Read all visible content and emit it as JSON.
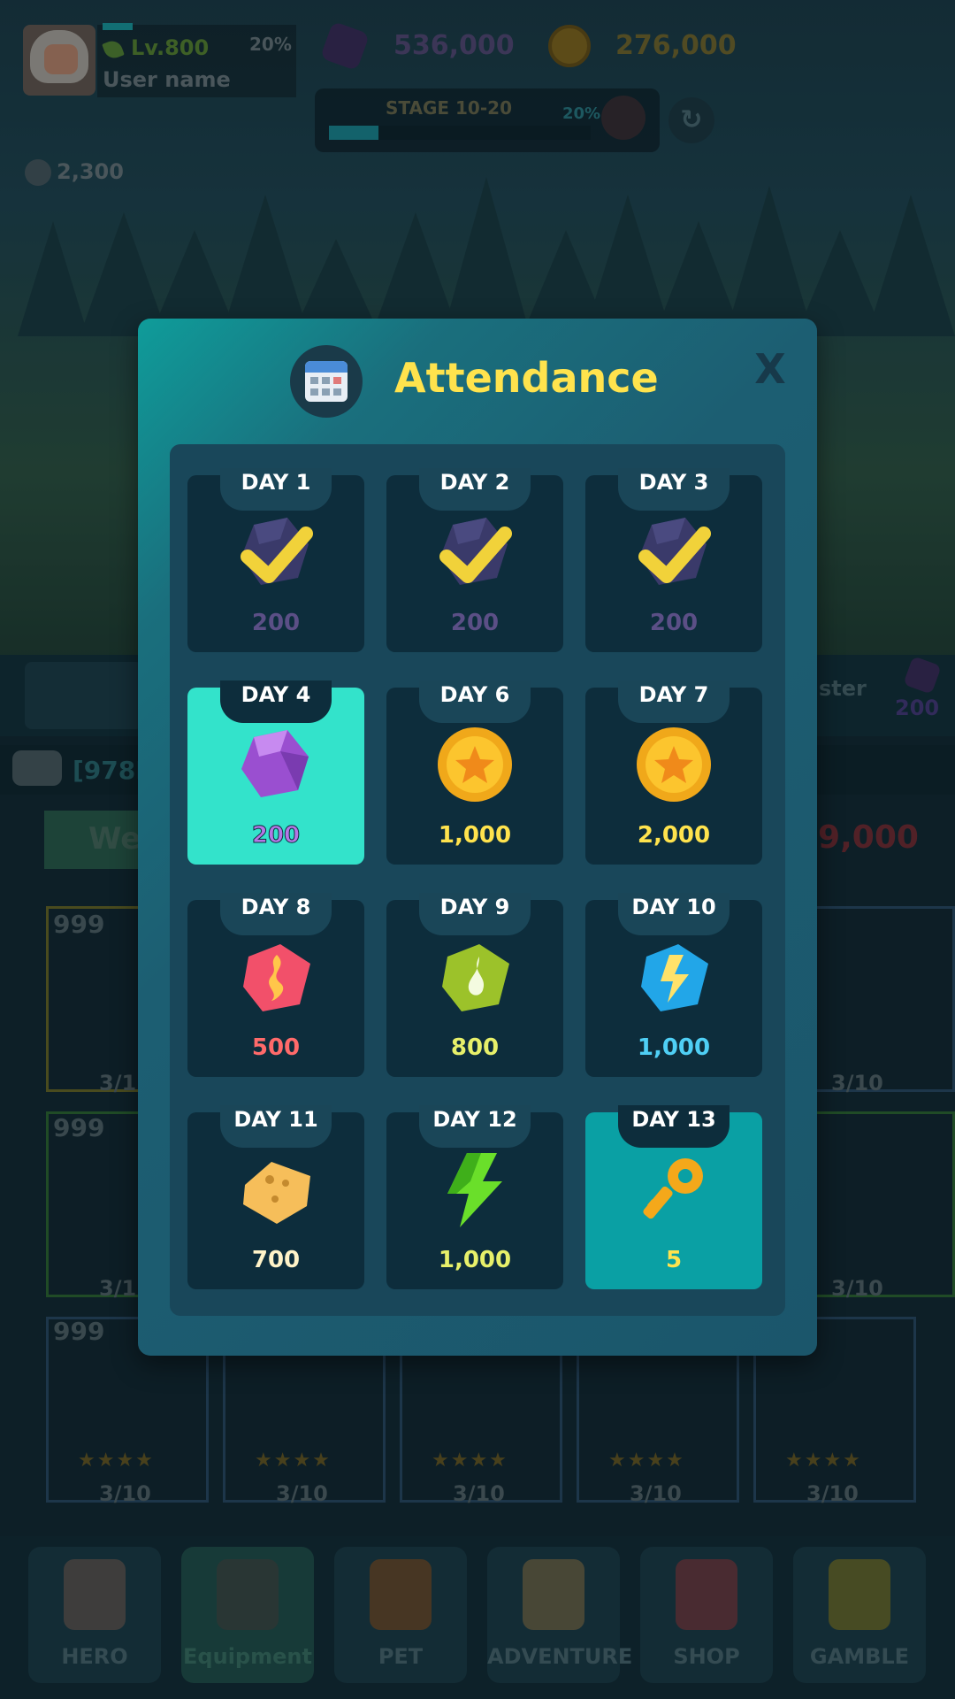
{
  "header": {
    "level": "Lv.800",
    "level_progress": "20%",
    "user_name": "User name",
    "gems": "536,000",
    "coins": "276,000",
    "stage": "STAGE 10-20",
    "stage_progress": "20%",
    "skulls": "2,300"
  },
  "background": {
    "booster_label": "ster",
    "booster_cost": "200",
    "chat_text": "[978I",
    "weapon_tab": "We",
    "gold_right": "99,000",
    "card_counts": [
      "999",
      "999",
      "999"
    ],
    "card_progress": [
      "3/1",
      "3/1",
      "3/10",
      "3/10",
      "3/10",
      "3/10",
      "3/10",
      "3/10",
      "3/10"
    ]
  },
  "modal": {
    "title": "Attendance",
    "close_label": "X",
    "days": [
      {
        "label": "DAY 1",
        "value": "200",
        "reward": "gem",
        "claimed": true
      },
      {
        "label": "DAY 2",
        "value": "200",
        "reward": "gem",
        "claimed": true
      },
      {
        "label": "DAY 3",
        "value": "200",
        "reward": "gem",
        "claimed": true
      },
      {
        "label": "DAY 4",
        "value": "200",
        "reward": "gem",
        "claimed": false
      },
      {
        "label": "DAY 6",
        "value": "1,000",
        "reward": "coin",
        "claimed": false
      },
      {
        "label": "DAY 7",
        "value": "2,000",
        "reward": "coin",
        "claimed": false
      },
      {
        "label": "DAY 8",
        "value": "500",
        "reward": "fire-stone",
        "claimed": false
      },
      {
        "label": "DAY 9",
        "value": "800",
        "reward": "green-stone",
        "claimed": false
      },
      {
        "label": "DAY 10",
        "value": "1,000",
        "reward": "lightning-stone",
        "claimed": false
      },
      {
        "label": "DAY 11",
        "value": "700",
        "reward": "cheese-block",
        "claimed": false
      },
      {
        "label": "DAY 12",
        "value": "1,000",
        "reward": "lightning-bolt",
        "claimed": false
      },
      {
        "label": "DAY 13",
        "value": "5",
        "reward": "key",
        "claimed": false
      }
    ]
  },
  "nav": {
    "items": [
      {
        "label": "HERO",
        "icon": "hero-icon"
      },
      {
        "label": "Equipment",
        "icon": "axe-icon"
      },
      {
        "label": "PET",
        "icon": "pet-icon"
      },
      {
        "label": "ADVENTURE",
        "icon": "map-icon"
      },
      {
        "label": "SHOP",
        "icon": "pouch-icon"
      },
      {
        "label": "GAMBLE",
        "icon": "dice-icon"
      }
    ]
  },
  "colors": {
    "title": "#ffe34d",
    "today_card": "#33e3cb",
    "special_card": "#0aa0a4",
    "gem_value": "#b98ad8",
    "coin_value": "#ffe34d",
    "fire_value": "#ff6a6a",
    "green_value": "#e7f06a",
    "blue_value": "#4fcff5"
  }
}
